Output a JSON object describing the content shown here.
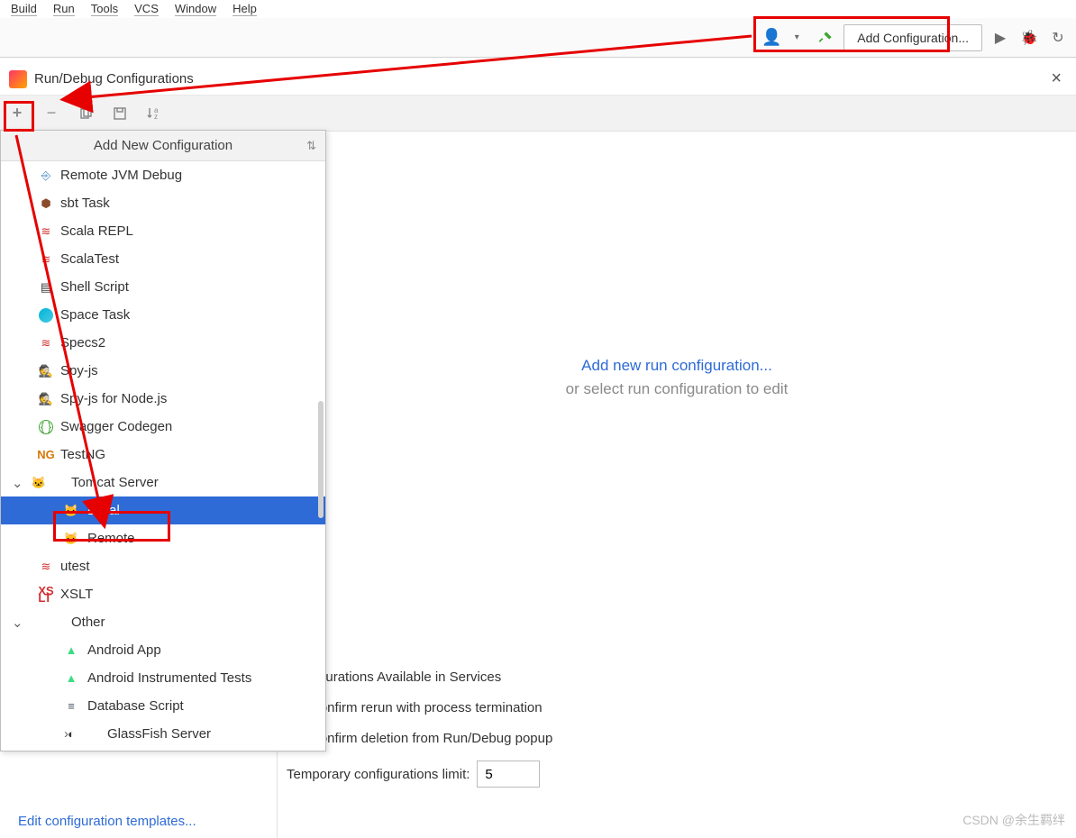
{
  "menubar": [
    "Build",
    "Run",
    "Tools",
    "VCS",
    "Window",
    "Help"
  ],
  "toolbar": {
    "add_config_label": "Add Configuration..."
  },
  "dialog": {
    "title": "Run/Debug Configurations"
  },
  "popup": {
    "title": "Add New Configuration",
    "items": [
      {
        "label": "Remote JVM Debug",
        "icon": "remote-icon"
      },
      {
        "label": "sbt Task",
        "icon": "sbt-icon"
      },
      {
        "label": "Scala REPL",
        "icon": "scala-icon"
      },
      {
        "label": "ScalaTest",
        "icon": "scalatest-icon"
      },
      {
        "label": "Shell Script",
        "icon": "shell-icon"
      },
      {
        "label": "Space Task",
        "icon": "space-icon"
      },
      {
        "label": "Specs2",
        "icon": "specs2-icon"
      },
      {
        "label": "Spy-js",
        "icon": "spyjs-icon"
      },
      {
        "label": "Spy-js for Node.js",
        "icon": "spyjs-node-icon"
      },
      {
        "label": "Swagger Codegen",
        "icon": "swagger-icon"
      },
      {
        "label": "TestNG",
        "icon": "testng-icon"
      },
      {
        "label": "Tomcat Server",
        "icon": "tomcat-icon",
        "expandable": true,
        "expanded": true
      },
      {
        "label": "Local",
        "icon": "tomcat-icon",
        "child": true,
        "selected": true
      },
      {
        "label": "Remote",
        "icon": "tomcat-icon",
        "child": true
      },
      {
        "label": "utest",
        "icon": "utest-icon"
      },
      {
        "label": "XSLT",
        "icon": "xslt-icon"
      },
      {
        "label": "Other",
        "expandable": true,
        "expanded": true
      },
      {
        "label": "Android App",
        "icon": "android-icon",
        "child": true
      },
      {
        "label": "Android Instrumented Tests",
        "icon": "android-test-icon",
        "child": true
      },
      {
        "label": "Database Script",
        "icon": "db-icon",
        "child": true
      },
      {
        "label": "GlassFish Server",
        "icon": "glassfish-icon",
        "child": true,
        "expandable": true
      }
    ]
  },
  "right": {
    "link": "Add new run configuration...",
    "sub": "or select run configuration to edit",
    "avail_label": "Configurations Available in Services",
    "confirm_rerun": "Confirm rerun with process termination",
    "confirm_delete": "Confirm deletion from Run/Debug popup",
    "temp_limit_label": "Temporary configurations limit:",
    "temp_limit_value": "5"
  },
  "edit_templates": "Edit configuration templates...",
  "watermark": "CSDN @余生羁绊"
}
